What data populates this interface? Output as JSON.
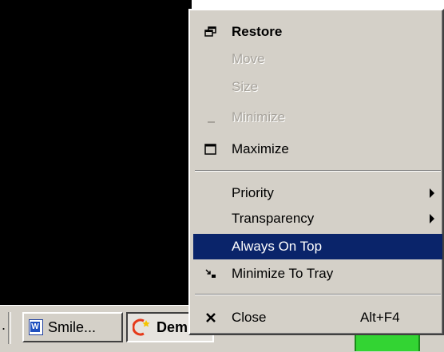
{
  "menu": {
    "restore": "Restore",
    "move": "Move",
    "size": "Size",
    "minimize": "Minimize",
    "maximize": "Maximize",
    "priority": "Priority",
    "transparency": "Transparency",
    "always_on_top": "Always On Top",
    "minimize_to_tray": "Minimize To Tray",
    "close": "Close",
    "close_shortcut": "Alt+F4"
  },
  "taskbar": {
    "tasks": [
      {
        "label": "Smile...",
        "icon": "word-document-icon"
      },
      {
        "label": "Dem...",
        "icon": "demo-app-icon",
        "active": true
      }
    ],
    "separator_text": "."
  },
  "colors": {
    "highlight": "#0a246a",
    "menu_bg": "#d4d0c8",
    "tray_green": "#33d433"
  }
}
